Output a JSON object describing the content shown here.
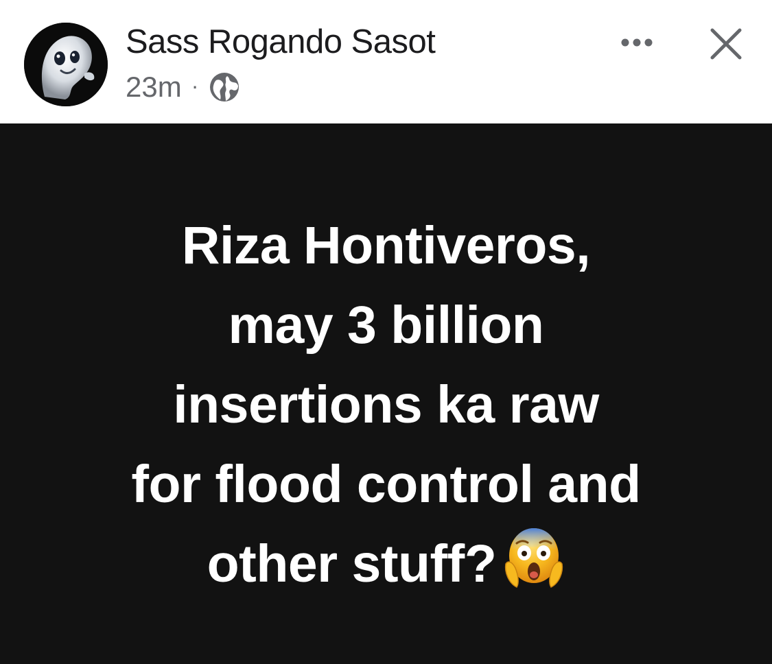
{
  "post": {
    "author_name": "Sass Rogando Sasot",
    "timestamp": "23m",
    "separator": "·",
    "privacy_icon": "globe-icon",
    "more_icon": "more-options-icon",
    "close_icon": "close-icon",
    "status_lines": [
      "Riza Hontiveros,",
      "may 3 billion",
      "insertions ka raw",
      "for flood control and",
      "other stuff?"
    ],
    "emoji": "face-screaming-in-fear",
    "background_color": "#121212",
    "text_color": "#ffffff"
  }
}
